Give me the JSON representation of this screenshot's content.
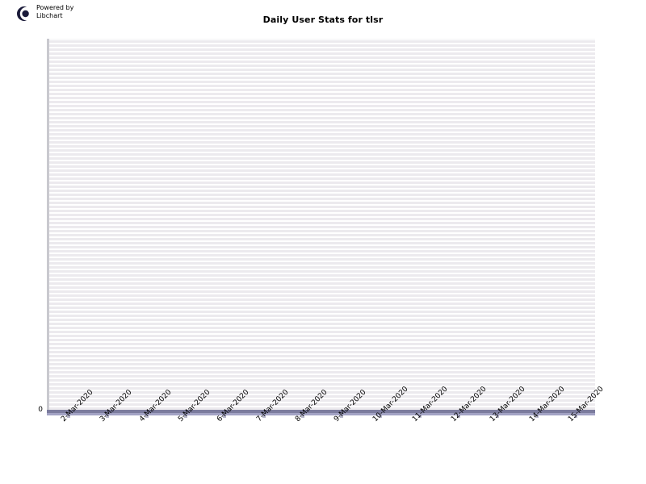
{
  "branding": {
    "logo_icon": "libchart-logo-icon",
    "line1": "Powered by",
    "line2": "Libchart"
  },
  "chart_data": {
    "type": "line",
    "title": "Daily User Stats for tlsr",
    "xlabel": "",
    "ylabel": "",
    "grid": true,
    "legend": "none",
    "ylim": [
      0,
      1
    ],
    "yticks": [
      "0"
    ],
    "categories": [
      "2-Mar-2020",
      "3-Mar-2020",
      "4-Mar-2020",
      "5-Mar-2020",
      "6-Mar-2020",
      "7-Mar-2020",
      "8-Mar-2020",
      "9-Mar-2020",
      "10-Mar-2020",
      "11-Mar-2020",
      "12-Mar-2020",
      "13-Mar-2020",
      "14-Mar-2020",
      "15-Mar-2020"
    ],
    "values": [
      0,
      0,
      0,
      0,
      0,
      0,
      0,
      0,
      0,
      0,
      0,
      0,
      0,
      0
    ],
    "colors": {
      "axis": "#7c7c9e",
      "axis_shadow": "#a3a3c4",
      "grid_stripe": "#eceaee",
      "plot_background": "#ffffff",
      "plot_border": "#c9c9cf",
      "text": "#000000",
      "logo": "#1b1b3a"
    }
  }
}
